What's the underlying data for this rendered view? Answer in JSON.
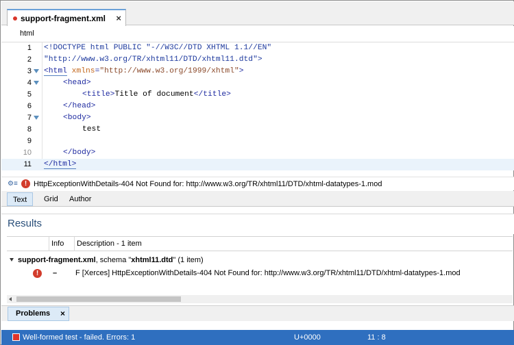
{
  "editor_tab": {
    "label": "support-fragment.xml",
    "close": "×"
  },
  "breadcrumb": "html",
  "lines": [
    {
      "n": "1"
    },
    {
      "n": "2"
    },
    {
      "n": "3"
    },
    {
      "n": "4"
    },
    {
      "n": "5"
    },
    {
      "n": "6"
    },
    {
      "n": "7"
    },
    {
      "n": "8"
    },
    {
      "n": "9"
    },
    {
      "n": "10"
    },
    {
      "n": "11"
    }
  ],
  "code": {
    "l1": "<!DOCTYPE html PUBLIC \"-//W3C//DTD XHTML 1.1//EN\"",
    "l2": "\"http://www.w3.org/TR/xhtml11/DTD/xhtml11.dtd\">",
    "l3_tag": "<html",
    "l3_attr": " xmlns",
    "l3_eq": "=",
    "l3_val": "\"http://www.w3.org/1999/xhtml\"",
    "l3_close": ">",
    "l4": "<head>",
    "l5_open": "<title>",
    "l5_text": "Title of document",
    "l5_close": "</title>",
    "l6": "</head>",
    "l7": "<body>",
    "l8": "test",
    "l10": "</body>",
    "l11": "</html>"
  },
  "error_bar": {
    "text": "HttpExceptionWithDetails-404 Not Found for: http://www.w3.org/TR/xhtml11/DTD/xhtml-datatypes-1.mod"
  },
  "modes": {
    "text": "Text",
    "grid": "Grid",
    "author": "Author"
  },
  "results": {
    "title": "Results",
    "col_info": "Info",
    "col_description": "Description - 1 item",
    "group_file": "support-fragment.xml",
    "group_sep": ", schema \"",
    "group_schema": "xhtml11.dtd",
    "group_tail": "\" (1 item)",
    "row_dash": "–",
    "row_message": "F [Xerces] HttpExceptionWithDetails-404 Not Found for: http://www.w3.org/TR/xhtml11/DTD/xhtml-datatypes-1.mod"
  },
  "problems_tab": {
    "label": "Problems",
    "close": "×"
  },
  "status": {
    "message": "Well-formed test - failed. Errors: 1",
    "encoding": "U+0000",
    "position": "11 : 8"
  },
  "colors": {
    "status_bar": "#2f6fbf",
    "error": "#d23c2c",
    "tag": "#1e2aa0",
    "attr": "#c2661b"
  }
}
